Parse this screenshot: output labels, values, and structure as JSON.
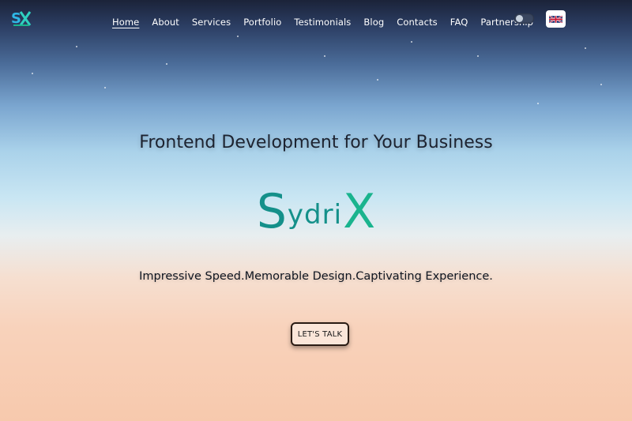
{
  "nav": {
    "logo_icon": "sx-logo",
    "items": [
      {
        "label": "Home",
        "active": true
      },
      {
        "label": "About"
      },
      {
        "label": "Services"
      },
      {
        "label": "Portfolio"
      },
      {
        "label": "Testimonials"
      },
      {
        "label": "Blog"
      },
      {
        "label": "Contacts"
      },
      {
        "label": "FAQ"
      },
      {
        "label": "Partnership"
      }
    ],
    "theme_toggle_icon": "theme-toggle",
    "language_icon": "uk-flag-icon"
  },
  "hero": {
    "headline": "Frontend Development for Your Business",
    "brand": {
      "first": "S",
      "middle": "ydri",
      "last": "X"
    },
    "tagline": "Impressive Speed.Memorable Design.Captivating Experience.",
    "cta_label": "LET'S TALK"
  },
  "colors": {
    "brand_teal": "#14908a",
    "brand_green": "#1ab48e",
    "text_dark": "#1d2330"
  }
}
